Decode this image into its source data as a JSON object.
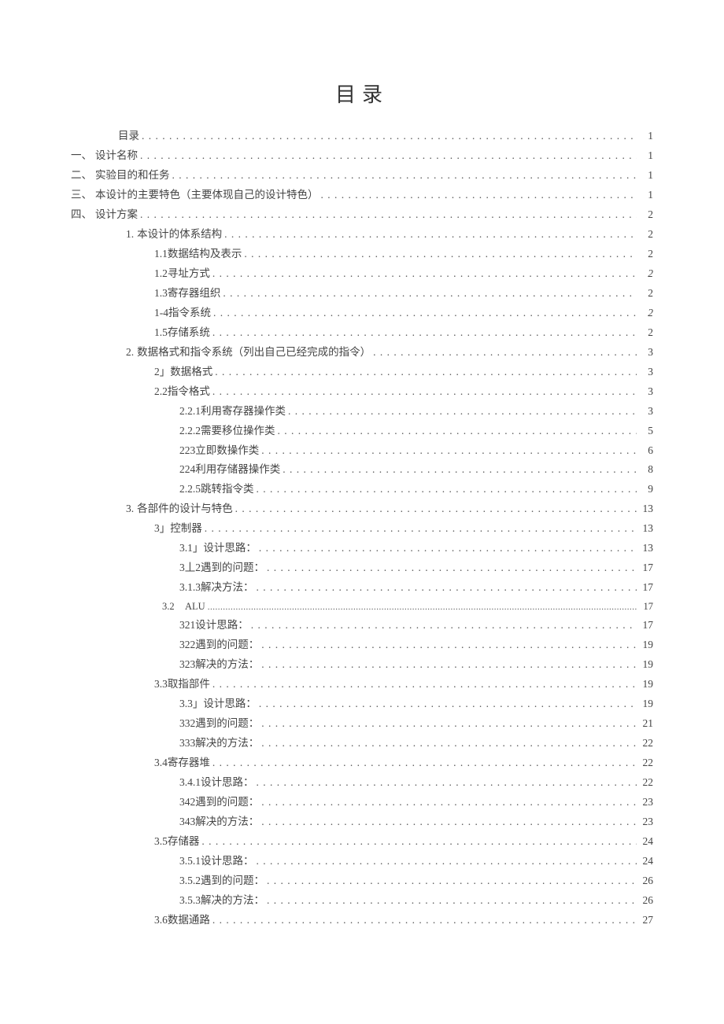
{
  "title": "目录",
  "entries": [
    {
      "indent": "ind-nsp",
      "prefix": "",
      "text": "目录",
      "page": "1",
      "dots": "wide"
    },
    {
      "indent": "ind-0",
      "prefix": "一、",
      "text": "设计名称",
      "page": "1",
      "dots": "wide"
    },
    {
      "indent": "ind-0",
      "prefix": "二、",
      "text": "实验目的和任务",
      "page": "1",
      "dots": "wide"
    },
    {
      "indent": "ind-0",
      "prefix": "三、",
      "text": "本设计的主要特色（主要体现自己的设计特色）",
      "page": "1",
      "dots": "wide"
    },
    {
      "indent": "ind-0",
      "prefix": "四、",
      "text": "设计方案",
      "page": "2",
      "dots": "wide"
    },
    {
      "indent": "ind-1",
      "prefix": "1.",
      "text": "本设计的体系结构",
      "page": "2",
      "dots": "wide"
    },
    {
      "indent": "ind-2",
      "prefix": "",
      "text": "1.1数据结构及表示",
      "page": "2",
      "dots": "wide"
    },
    {
      "indent": "ind-2",
      "prefix": "",
      "text": "1.2寻址方式",
      "page": "2",
      "dots": "wide",
      "italic": true
    },
    {
      "indent": "ind-2",
      "prefix": "",
      "text": "1.3寄存器组织",
      "page": "2",
      "dots": "wide"
    },
    {
      "indent": "ind-2",
      "prefix": "",
      "text": "1-4指令系统",
      "page": "2",
      "dots": "wide",
      "italic": true
    },
    {
      "indent": "ind-2",
      "prefix": "",
      "text": "1.5存储系统",
      "page": "2",
      "dots": "wide"
    },
    {
      "indent": "ind-1",
      "prefix": "2.",
      "text": "数据格式和指令系统（列出自己已经完成的指令）",
      "page": "3",
      "dots": "wide"
    },
    {
      "indent": "ind-2",
      "prefix": "",
      "text": "2」数据格式",
      "page": "3",
      "dots": "wide"
    },
    {
      "indent": "ind-2",
      "prefix": "",
      "text": "2.2指令格式",
      "page": "3",
      "dots": "wide"
    },
    {
      "indent": "ind-3",
      "prefix": "",
      "text": "2.2.1利用寄存器操作类",
      "page": "3",
      "dots": "wide"
    },
    {
      "indent": "ind-3",
      "prefix": "",
      "text": "2.2.2需要移位操作类",
      "page": "5",
      "dots": "wide"
    },
    {
      "indent": "ind-3",
      "prefix": "",
      "text": "223立即数操作类",
      "page": "6",
      "dots": "wide"
    },
    {
      "indent": "ind-3",
      "prefix": "",
      "text": "224利用存储器操作类",
      "page": "8",
      "dots": "wide"
    },
    {
      "indent": "ind-3",
      "prefix": "",
      "text": "2.2.5跳转指令类",
      "page": "9",
      "dots": "wide"
    },
    {
      "indent": "ind-1",
      "prefix": "3.",
      "text": "各部件的设计与特色",
      "page": "13",
      "dots": "wide"
    },
    {
      "indent": "ind-2",
      "prefix": "",
      "text": "3」控制器",
      "page": "13",
      "dots": "wide"
    },
    {
      "indent": "ind-3",
      "prefix": "",
      "text": "3.1」设计思路：",
      "page": "13",
      "dots": "wide"
    },
    {
      "indent": "ind-3",
      "prefix": "",
      "text": "3丄2遇到的问题：",
      "page": "17",
      "dots": "wide"
    },
    {
      "indent": "ind-3",
      "prefix": "",
      "text": "3.1.3解决方法：",
      "page": "17",
      "dots": "wide"
    },
    {
      "indent": "ind-3b",
      "prefix": "3.2",
      "text": "ALU",
      "page": "17",
      "dots": "fine",
      "alu": true
    },
    {
      "indent": "ind-3",
      "prefix": "",
      "text": "321设计思路：",
      "page": "17",
      "dots": "wide"
    },
    {
      "indent": "ind-3",
      "prefix": "",
      "text": "322遇到的问题：",
      "page": "19",
      "dots": "wide"
    },
    {
      "indent": "ind-3",
      "prefix": "",
      "text": "323解决的方法：",
      "page": "19",
      "dots": "wide"
    },
    {
      "indent": "ind-2",
      "prefix": "",
      "text": "3.3取指部件",
      "page": "19",
      "dots": "wide"
    },
    {
      "indent": "ind-3",
      "prefix": "",
      "text": "3.3」设计思路：",
      "page": "19",
      "dots": "wide"
    },
    {
      "indent": "ind-3",
      "prefix": "",
      "text": "332遇到的问题：",
      "page": "21",
      "dots": "wide"
    },
    {
      "indent": "ind-3",
      "prefix": "",
      "text": "333解决的方法：",
      "page": "22",
      "dots": "wide"
    },
    {
      "indent": "ind-2",
      "prefix": "",
      "text": "3.4寄存器堆",
      "page": "22",
      "dots": "wide"
    },
    {
      "indent": "ind-3",
      "prefix": "",
      "text": "3.4.1设计思路：",
      "page": "22",
      "dots": "wide"
    },
    {
      "indent": "ind-3",
      "prefix": "",
      "text": "342遇到的问题：",
      "page": "23",
      "dots": "wide"
    },
    {
      "indent": "ind-3",
      "prefix": "",
      "text": "343解决的方法：",
      "page": "23",
      "dots": "wide"
    },
    {
      "indent": "ind-2",
      "prefix": "",
      "text": "3.5存储器",
      "page": "24",
      "dots": "wide"
    },
    {
      "indent": "ind-3",
      "prefix": "",
      "text": "3.5.1设计思路：",
      "page": "24",
      "dots": "wide"
    },
    {
      "indent": "ind-3",
      "prefix": "",
      "text": "3.5.2遇到的问题：",
      "page": "26",
      "dots": "wide"
    },
    {
      "indent": "ind-3",
      "prefix": "",
      "text": "3.5.3解决的方法：",
      "page": "26",
      "dots": "wide"
    },
    {
      "indent": "ind-2",
      "prefix": "",
      "text": "3.6数据通路",
      "page": "27",
      "dots": "wide"
    }
  ]
}
